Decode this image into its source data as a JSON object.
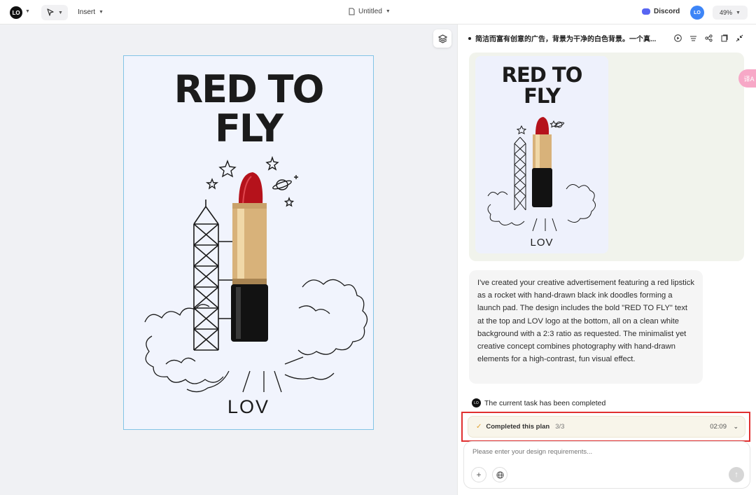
{
  "topbar": {
    "logo_text": "LO",
    "insert_label": "Insert",
    "doc_title": "Untitled",
    "discord_label": "Discord",
    "avatar_text": "LO",
    "zoom": "49%"
  },
  "canvas": {
    "poster": {
      "title_line1": "RED TO",
      "title_line2": "FLY",
      "brand": "LOV"
    }
  },
  "panel": {
    "header_title": "简洁而富有创意的广告，背景为干净的白色背景。一个真...",
    "header_icons": [
      "play-icon",
      "history-icon",
      "share-icon",
      "export-icon",
      "collapse-icon"
    ],
    "preview": {
      "title_line1": "RED TO",
      "title_line2": "FLY",
      "brand": "LOV"
    },
    "translate_badge": "译A",
    "message": "I've created your creative advertisement featuring a red lipstick as a rocket with hand-drawn black ink doodles forming a launch pad. The design includes the bold \"RED TO FLY\" text at the top and LOV logo at the bottom, all on a clean white background with a 2:3 ratio as requested. The minimalist yet creative concept combines photography with hand-drawn elements for a high-contrast, fun visual effect.",
    "status": "The current task has been completed",
    "plan": {
      "label": "Completed this plan",
      "count": "3/3",
      "time": "02:09"
    },
    "input": {
      "placeholder": "Please enter your design requirements..."
    }
  },
  "colors": {
    "accent_blue": "#3d85f7",
    "poster_border": "#82c4e6",
    "highlight": "#e03030",
    "lipstick_red": "#b5121b"
  }
}
